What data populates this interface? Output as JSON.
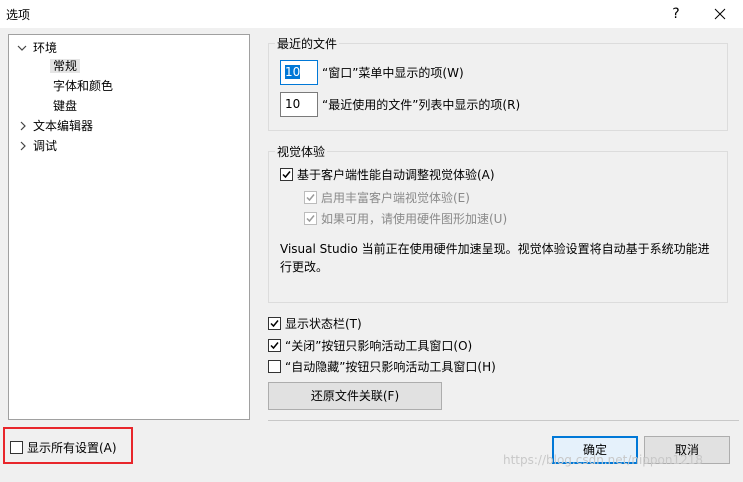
{
  "window": {
    "title": "选项",
    "help_glyph": "?"
  },
  "tree": {
    "items": [
      {
        "label": "环境"
      },
      {
        "label": "常规"
      },
      {
        "label": "字体和颜色"
      },
      {
        "label": "键盘"
      },
      {
        "label": "文本编辑器"
      },
      {
        "label": "调试"
      }
    ]
  },
  "recent_files": {
    "legend": "最近的文件",
    "window_menu_count": "10",
    "window_menu_label": "“窗口”菜单中显示的项(W)",
    "recent_list_count": "10",
    "recent_list_label": "“最近使用的文件”列表中显示的项(R)"
  },
  "visual_experience": {
    "legend": "视觉体验",
    "auto_adjust_label": "基于客户端性能自动调整视觉体验(A)",
    "rich_client_label": "启用丰富客户端视觉体验(E)",
    "hw_accel_label": "如果可用，请使用硬件图形加速(U)",
    "description": "Visual Studio 当前正在使用硬件加速呈现。视觉体验设置将自动基于系统功能进行更改。"
  },
  "options": {
    "status_bar_label": "显示状态栏(T)",
    "close_button_label": "“关闭”按钮只影响活动工具窗口(O)",
    "autohide_button_label": "“自动隐藏”按钮只影响活动工具窗口(H)",
    "restore_assoc_button": "还原文件关联(F)"
  },
  "footer": {
    "show_all_label": "显示所有设置(A)",
    "ok_button": "确定",
    "cancel_button": "取消",
    "watermark": "https://blog.csdn.net/nippon1218"
  }
}
